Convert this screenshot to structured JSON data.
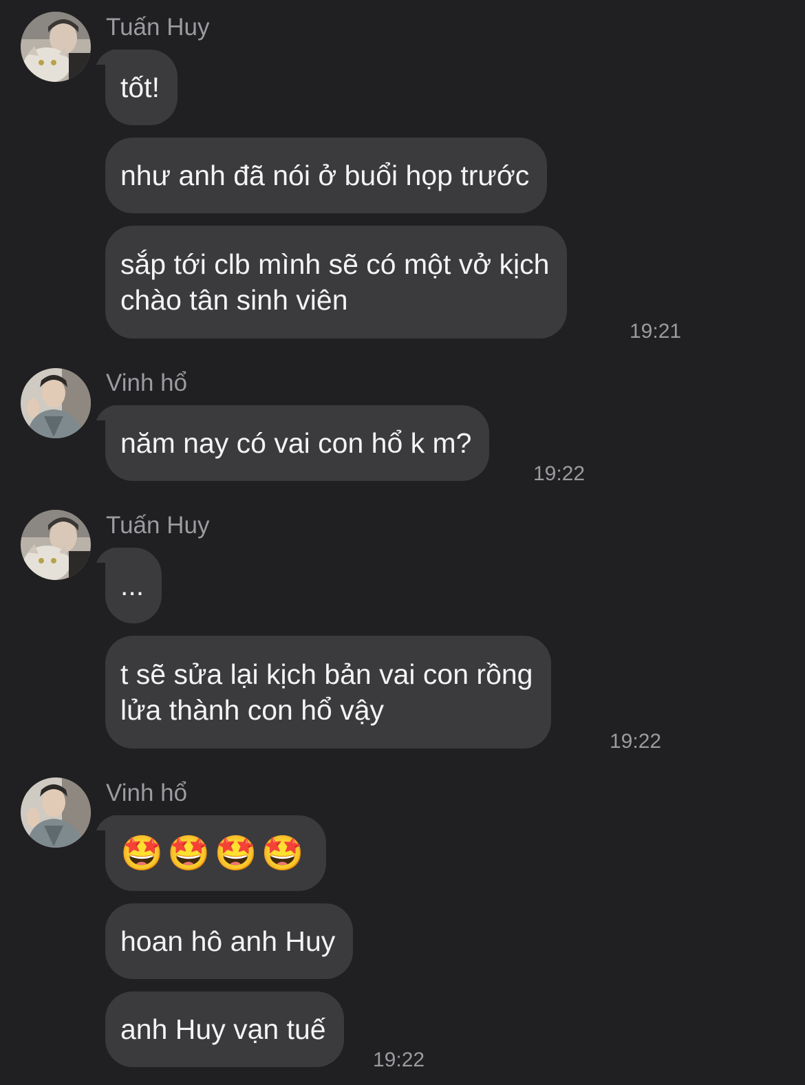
{
  "messages": [
    {
      "sender": "Tuấn Huy",
      "avatar": "avatar-tuan-huy-icon",
      "bubbles": [
        "tốt!",
        "như anh đã nói ở buổi họp trước",
        "sắp tới clb mình sẽ có một vở kịch\nchào tân sinh viên"
      ],
      "time": "19:21"
    },
    {
      "sender": "Vinh hổ",
      "avatar": "avatar-vinh-ho-icon",
      "bubbles": [
        "năm nay có vai con hổ k m?"
      ],
      "time": "19:22"
    },
    {
      "sender": "Tuấn Huy",
      "avatar": "avatar-tuan-huy-icon",
      "bubbles": [
        "...",
        "t sẽ sửa lại kịch bản vai con rồng\nlửa thành con hổ vậy"
      ],
      "time": "19:22"
    },
    {
      "sender": "Vinh hổ",
      "avatar": "avatar-vinh-ho-icon",
      "bubbles": [
        "🤩🤩🤩🤩",
        "hoan hô anh Huy",
        "anh Huy vạn tuế"
      ],
      "time": "19:22"
    }
  ],
  "colors": {
    "background": "#202022",
    "bubble": "#3b3b3e",
    "text": "#f4f4f6",
    "meta": "#9b9ba0"
  }
}
